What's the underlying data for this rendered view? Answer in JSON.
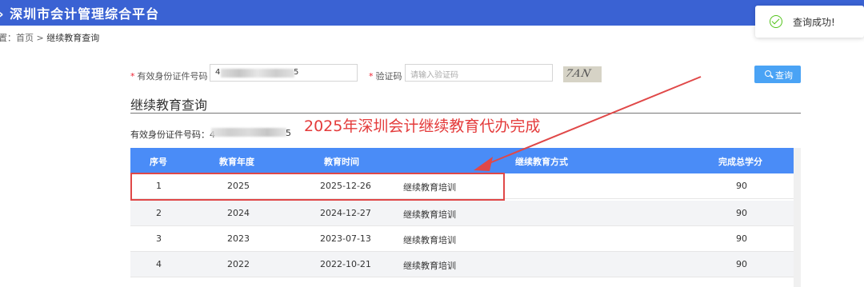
{
  "header": {
    "title": "› 深圳市会计管理综合平台"
  },
  "breadcrumb": {
    "prefix": "置：",
    "home": "首页",
    "sep": ">",
    "current": "继续教育查询"
  },
  "toast": {
    "message": "查询成功!"
  },
  "form": {
    "id_label": "有效身份证件号码",
    "id_value_start": "4",
    "id_value_end": "5",
    "captcha_label": "验证码",
    "captcha_placeholder": "请输入验证码",
    "captcha_image_text": "7AN",
    "query_button": "查询"
  },
  "section": {
    "title": "继续教育查询"
  },
  "id_line": {
    "label": "有效身份证件号码：",
    "value_start": "4",
    "value_end": "5"
  },
  "annotation": {
    "text": "2025年深圳会计继续教育代办完成"
  },
  "table": {
    "headers": [
      "序号",
      "教育年度",
      "教育时间",
      "继续教育方式",
      "完成总学分"
    ],
    "rows": [
      [
        "1",
        "2025",
        "2025-12-26",
        "继续教育培训",
        "90"
      ],
      [
        "2",
        "2024",
        "2024-12-27",
        "继续教育培训",
        "90"
      ],
      [
        "3",
        "2023",
        "2023-07-13",
        "继续教育培训",
        "90"
      ],
      [
        "4",
        "2022",
        "2022-10-21",
        "继续教育培训",
        "90"
      ]
    ]
  },
  "colors": {
    "header_bg": "#3a62d3",
    "table_header_bg": "#4a8cf7",
    "button_bg": "#4aa3f5",
    "annotation": "#e43b3b",
    "success": "#52c41a"
  }
}
